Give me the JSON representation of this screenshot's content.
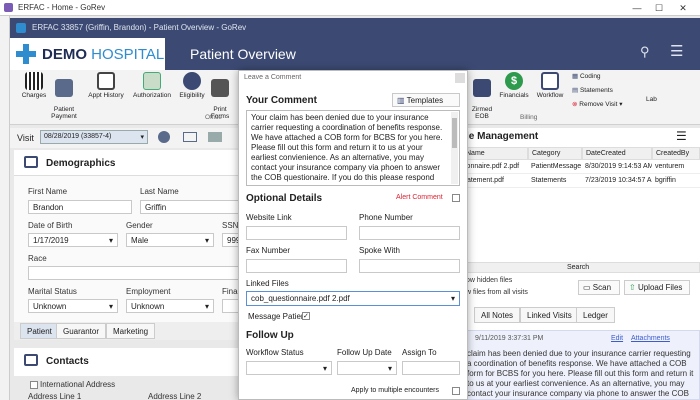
{
  "outer_window": {
    "title": "ERFAC - Home - GoRev",
    "minimize": "—",
    "maximize": "☐",
    "close": "✕"
  },
  "inner_window": {
    "title": "ERFAC 33857 (Griffin, Brandon) - Patient Overview - GoRev"
  },
  "logo": {
    "part1": "DEMO",
    "part2": " HOSPITAL"
  },
  "page_title": "Patient Overview",
  "ribbon": {
    "items": [
      {
        "label": "Charges",
        "icon": "barcode-icon"
      },
      {
        "label": "Patient\nPayment",
        "icon": "payment-icon"
      },
      {
        "label": "Appt History",
        "icon": "calendar-icon"
      },
      {
        "label": "Authorization",
        "icon": "authorization-icon"
      },
      {
        "label": "Eligibility",
        "icon": "eligibility-icon"
      },
      {
        "label": "Print\nForms",
        "icon": "printer-icon"
      }
    ],
    "office_label": "Office",
    "right_items": [
      {
        "label": "Zirmed\nEOB",
        "icon": "eob-icon"
      },
      {
        "label": "Financials",
        "icon": "dollar-icon"
      },
      {
        "label": "Workflow",
        "icon": "workflow-icon"
      }
    ],
    "list_items": [
      "Coding",
      "Statements",
      "Remove Visit ▾"
    ],
    "billing_label": "Billing",
    "lab_label": "Lab"
  },
  "visit": {
    "label": "Visit",
    "value": "08/28/2019 (33857-4)"
  },
  "demographics": {
    "title": "Demographics",
    "first_name_label": "First Name",
    "first_name": "Brandon",
    "last_name_label": "Last Name",
    "last_name": "Griffin",
    "dob_label": "Date of Birth",
    "dob": "1/17/2019",
    "gender_label": "Gender",
    "gender": "Male",
    "ssn_label": "SSN",
    "ssn": "999",
    "race_label": "Race",
    "marital_label": "Marital Status",
    "marital": "Unknown",
    "employment_label": "Employment",
    "employment": "Unknown",
    "fin_label": "Finar"
  },
  "left_tabs": [
    "Patient",
    "Guarantor",
    "Marketing"
  ],
  "contacts": {
    "title": "Contacts",
    "intl_label": "International Address",
    "addr1": "Address Line 1",
    "addr2": "Address Line 2"
  },
  "file_mgmt": {
    "title": "le Management",
    "columns": [
      "Name",
      "Category",
      "DateCreated",
      "CreatedBy"
    ],
    "rows": [
      [
        "ionnaire.pdf 2.pdf",
        "PatientMessage",
        "8/30/2019 9:14:53 AM",
        "venturem"
      ],
      [
        "tatement.pdf",
        "Statements",
        "7/23/2019 10:34:57 AM",
        "bgriffin"
      ]
    ],
    "search_label": "Search",
    "show_hidden": "ow hidden files",
    "show_all": "w files from all visits",
    "scan": "Scan",
    "upload": "Upload Files"
  },
  "right_tabs": [
    "All Notes",
    "Linked Visits",
    "Ledger"
  ],
  "note": {
    "date": "9/11/2019 3:37:31 PM",
    "edit": "Edit",
    "attachments": "Attachments",
    "text": "claim has been denied due to your insurance carrier requesting a coordination of benefits response. We have attached a COB form for BCBS for you here. Please fill out this form and return it to us at your earliest convenience. As an alternative, you may contact your insurance company via phone to answer the COB questionaire. If you do this please"
  },
  "dialog": {
    "title": "Leave a Comment",
    "your_comment": "Your Comment",
    "templates": "Templates",
    "comment_text": "Your claim has been denied due to your insurance carrier requesting a coordination of benefits response.  We have attached a COB form for BCBS for you here.  Please fill out this form and return it to us at your earliest convienience.  As an alternative, you may contact your insurance company via phoen to answer the COB questionaire.  If you do this please respond",
    "optional_details": "Optional Details",
    "alert_comment": "Alert Comment",
    "website_link": "Website Link",
    "phone_number": "Phone Number",
    "fax_number": "Fax Number",
    "spoke_with": "Spoke With",
    "linked_files_label": "Linked Files",
    "linked_files_value": "cob_questionnaire.pdf 2.pdf",
    "message_patient": "Message Patient",
    "follow_up": "Follow Up",
    "workflow_status": "Workflow Status",
    "follow_up_date": "Follow Up Date",
    "assign_to": "Assign To",
    "apply_multiple": "Apply to multiple encounters"
  },
  "colors": {
    "brand_navy": "#3c4a73",
    "accent_blue": "#2f8ccf",
    "alert_red": "#d23"
  }
}
